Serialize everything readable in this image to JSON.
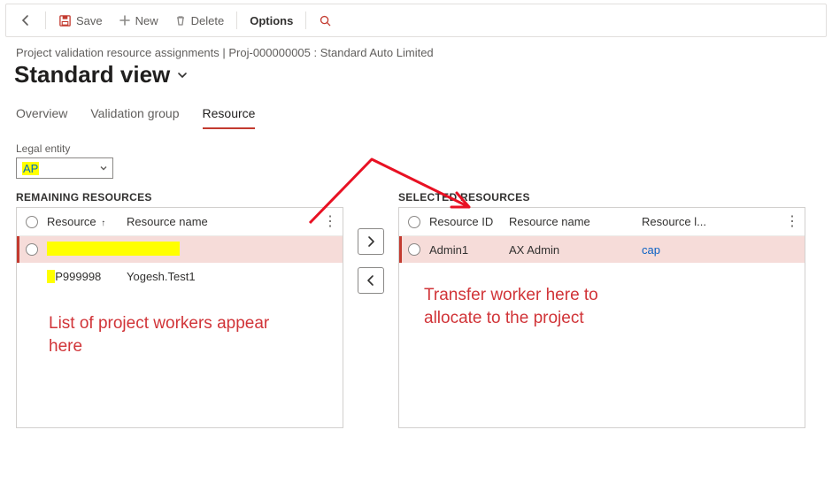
{
  "toolbar": {
    "save_label": "Save",
    "new_label": "New",
    "delete_label": "Delete",
    "options_label": "Options"
  },
  "breadcrumb": "Project validation resource assignments   |  Proj-000000005 : Standard Auto Limited",
  "page_title": "Standard view",
  "tabs": {
    "overview": "Overview",
    "validation_group": "Validation group",
    "resource": "Resource"
  },
  "legal_entity": {
    "label": "Legal entity",
    "value": "AP"
  },
  "left_panel": {
    "heading": "REMAINING RESOURCES",
    "columns": {
      "resource": "Resource",
      "resource_name": "Resource name"
    },
    "rows": [
      {
        "resource": "",
        "name": ""
      },
      {
        "resource": "P999998",
        "name": "Yogesh.Test1"
      }
    ],
    "annotation": "List of project workers appear here"
  },
  "right_panel": {
    "heading": "SELECTED RESOURCES",
    "columns": {
      "resource_id": "Resource ID",
      "resource_name": "Resource name",
      "resource_l": "Resource l..."
    },
    "rows": [
      {
        "resource_id": "Admin1",
        "name": "AX Admin",
        "legal": "cap"
      }
    ],
    "annotation": "Transfer worker here to allocate to the project"
  }
}
